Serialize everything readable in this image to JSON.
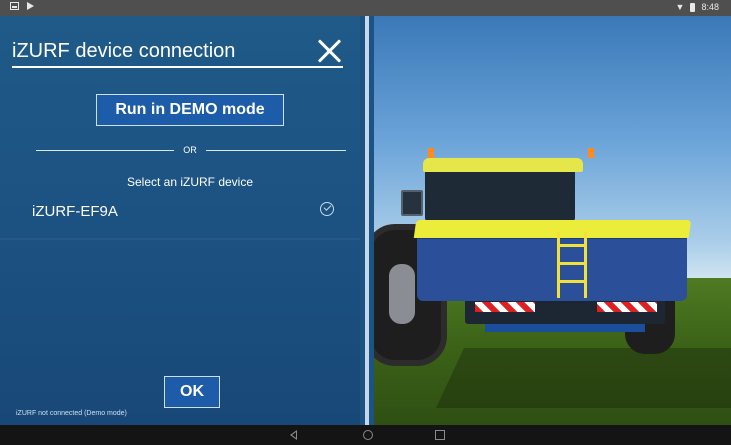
{
  "status_bar": {
    "time": "8:48",
    "icons": [
      "image-icon",
      "play-store-icon",
      "wifi-icon",
      "battery-icon"
    ]
  },
  "dialog": {
    "title": "iZURF device connection",
    "demo_button_label": "Run in DEMO mode",
    "separator_text": "OR",
    "select_label": "Select an iZURF device",
    "devices": [
      {
        "name": "iZURF-EF9A",
        "status_icon": "check-circle-icon"
      }
    ],
    "ok_button_label": "OK",
    "connection_status": "iZURF not connected (Demo mode)"
  },
  "nav_bar": {
    "icons": [
      "back-icon",
      "home-icon",
      "recents-icon"
    ]
  },
  "colors": {
    "panel_bg": "#1c5282",
    "button_bg": "#1c5ca8",
    "hopper_blue": "#2c4f9a",
    "lid_yellow": "#ecec3a"
  }
}
